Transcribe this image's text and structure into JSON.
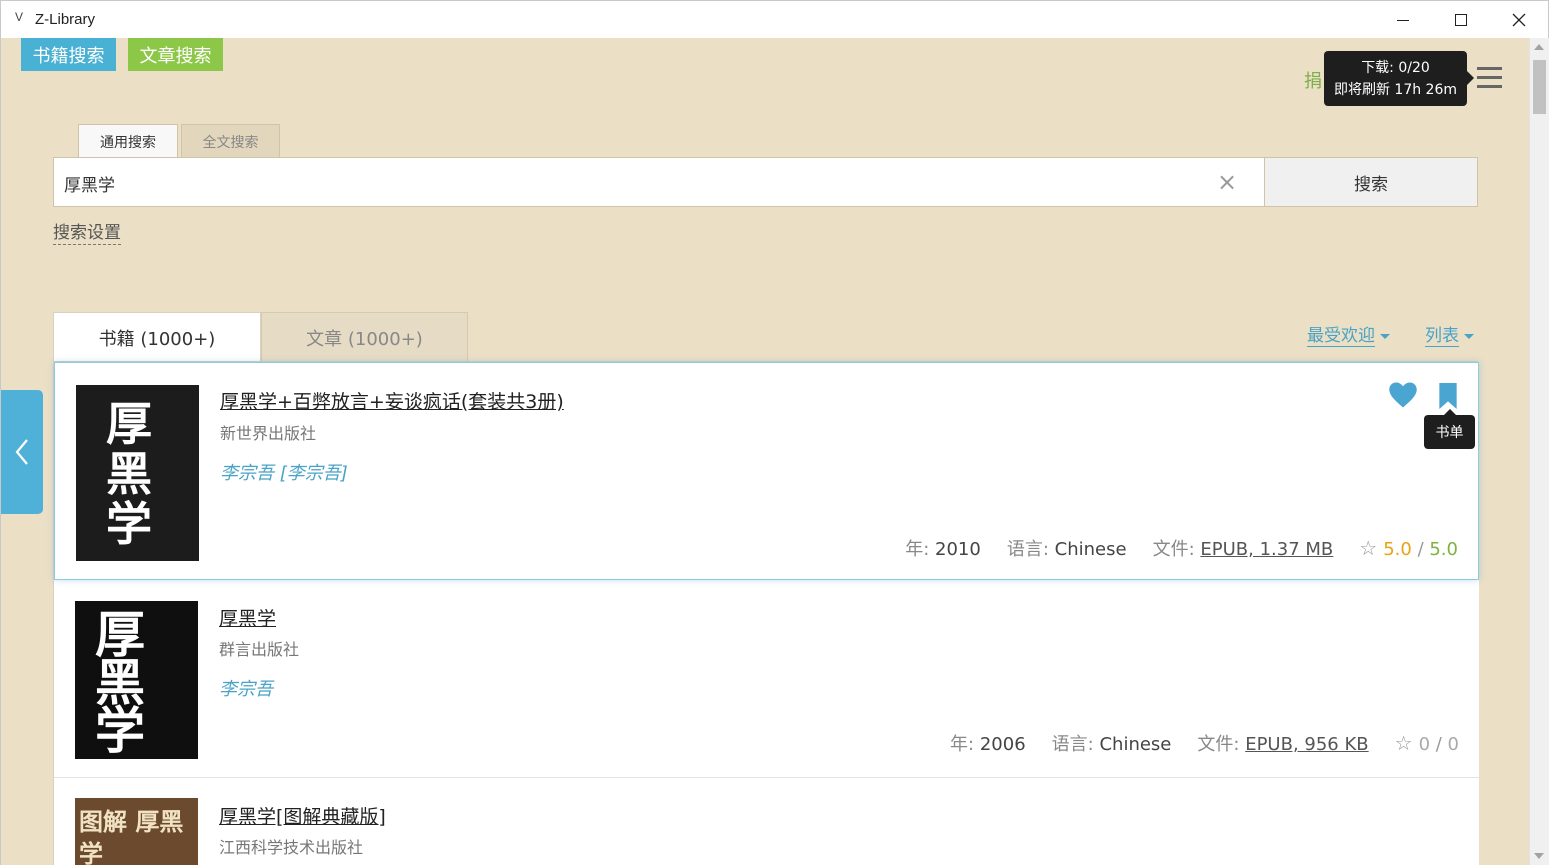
{
  "window": {
    "app_icon": "V",
    "title": "Z-Library",
    "controls": {
      "minimize": "minimize-icon",
      "maximize": "maximize-icon",
      "close": "✕"
    }
  },
  "header": {
    "books_button": "书籍搜索",
    "articles_button": "文章搜索",
    "partial_link": "捐",
    "download_tooltip": {
      "line1": "下载: 0/20",
      "line2": "即将刷新 17h 26m"
    }
  },
  "search": {
    "tabs": [
      "通用搜索",
      "全文搜索"
    ],
    "query": "厚黑学",
    "clear_icon": "×",
    "button": "搜索",
    "settings_link": "搜索设置"
  },
  "results": {
    "tabs": [
      "书籍 (1000+)",
      "文章 (1000+)"
    ],
    "sort_label": "最受欢迎",
    "view_label": "列表",
    "bookmark_tooltip": "书单",
    "year_label": "年:",
    "lang_label": "语言:",
    "file_label": "文件:",
    "books": [
      {
        "title": "厚黑学+百弊放言+妄谈疯话(套装共3册)",
        "publisher": "新世界出版社",
        "author": "李宗吾 [李宗吾]",
        "year": "2010",
        "language": "Chinese",
        "file": "EPUB, 1.37 MB",
        "rating": "5.0",
        "rating_max": "5.0",
        "cover_text": "厚黑学"
      },
      {
        "title": "厚黑学",
        "publisher": "群言出版社",
        "author": "李宗吾",
        "year": "2006",
        "language": "Chinese",
        "file": "EPUB, 956 KB",
        "rating": "0",
        "rating_max": "0",
        "cover_text": "厚黑学"
      },
      {
        "title": "厚黑学[图解典藏版]",
        "publisher": "江西科学技术出版社",
        "author": "",
        "cover_text": "图解 厚黑学"
      }
    ]
  },
  "colors": {
    "background": "#ebdfc6",
    "accent_blue": "#49b1d3",
    "accent_green": "#8dc748"
  }
}
